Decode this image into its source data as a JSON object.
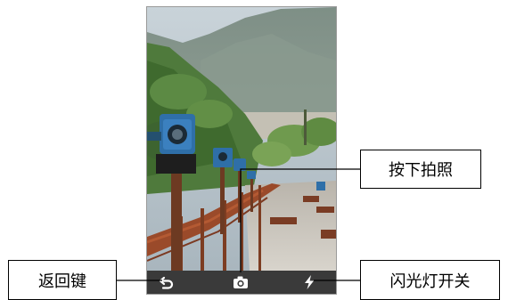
{
  "callouts": {
    "shutter_label": "按下拍照",
    "back_label": "返回键",
    "flash_label": "闪光灯开关"
  },
  "icons": {
    "back": "back-arrow-icon",
    "shutter": "camera-icon",
    "flash": "lightning-bolt-icon"
  },
  "colors": {
    "bottom_bar": "#3a3a3a",
    "icon": "#ffffff",
    "callout_border": "#000000"
  }
}
